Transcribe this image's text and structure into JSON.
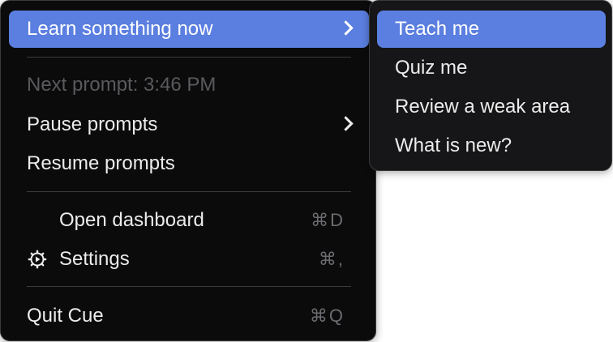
{
  "main_menu": {
    "items": [
      {
        "label": "Learn something now"
      },
      {
        "label": "Next prompt: 3:46 PM"
      },
      {
        "label": "Pause prompts"
      },
      {
        "label": "Resume prompts"
      },
      {
        "label": "Open dashboard",
        "shortcut": "⌘D"
      },
      {
        "label": "Settings",
        "shortcut": "⌘,"
      },
      {
        "label": "Quit Cue",
        "shortcut": "⌘Q"
      }
    ]
  },
  "sub_menu": {
    "items": [
      {
        "label": "Teach me"
      },
      {
        "label": "Quiz me"
      },
      {
        "label": "Review a weak area"
      },
      {
        "label": "What is new?"
      }
    ]
  },
  "icons": {
    "settings": "gear-icon",
    "submenu": "chevron-right-icon"
  },
  "colors": {
    "highlight": "#5b7fe0",
    "menu_bg": "#0b0b0c",
    "submenu_bg": "#161618"
  }
}
